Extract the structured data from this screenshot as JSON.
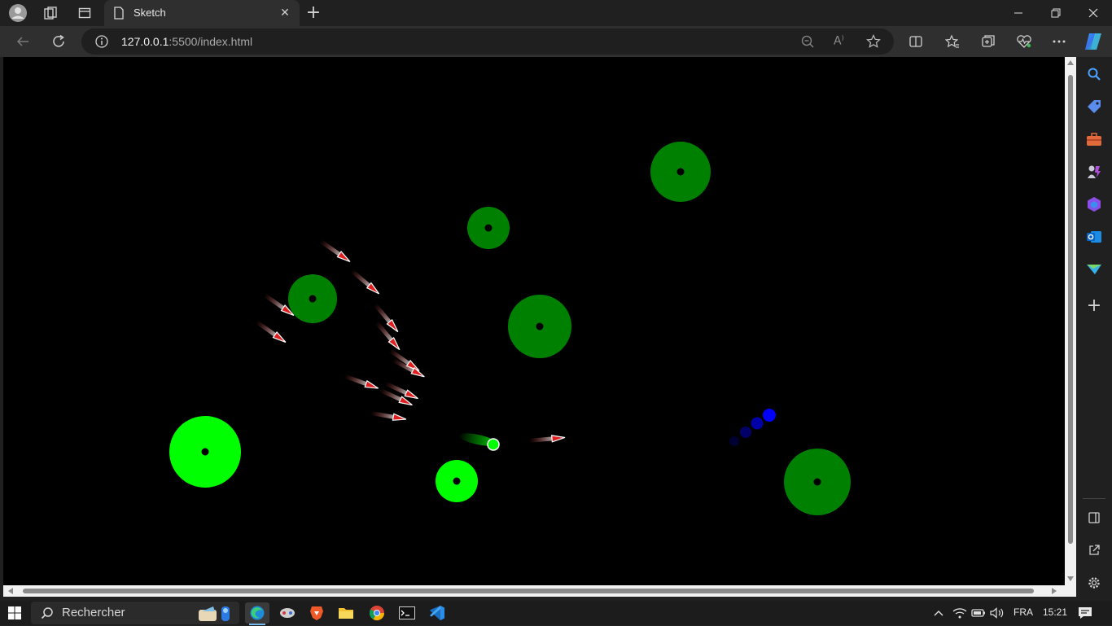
{
  "browser": {
    "tab_title": "Sketch",
    "url_host": "127.0.0.1",
    "url_rest": ":5500/index.html"
  },
  "canvas": {
    "background": "#000000",
    "colors": {
      "bright_green": "#00ff00",
      "dark_green": "#008000",
      "arrow_red": "#e02020",
      "blue": "#0000ff"
    }
  },
  "taskbar": {
    "search_placeholder": "Rechercher",
    "language": "FRA",
    "time": "15:21"
  }
}
